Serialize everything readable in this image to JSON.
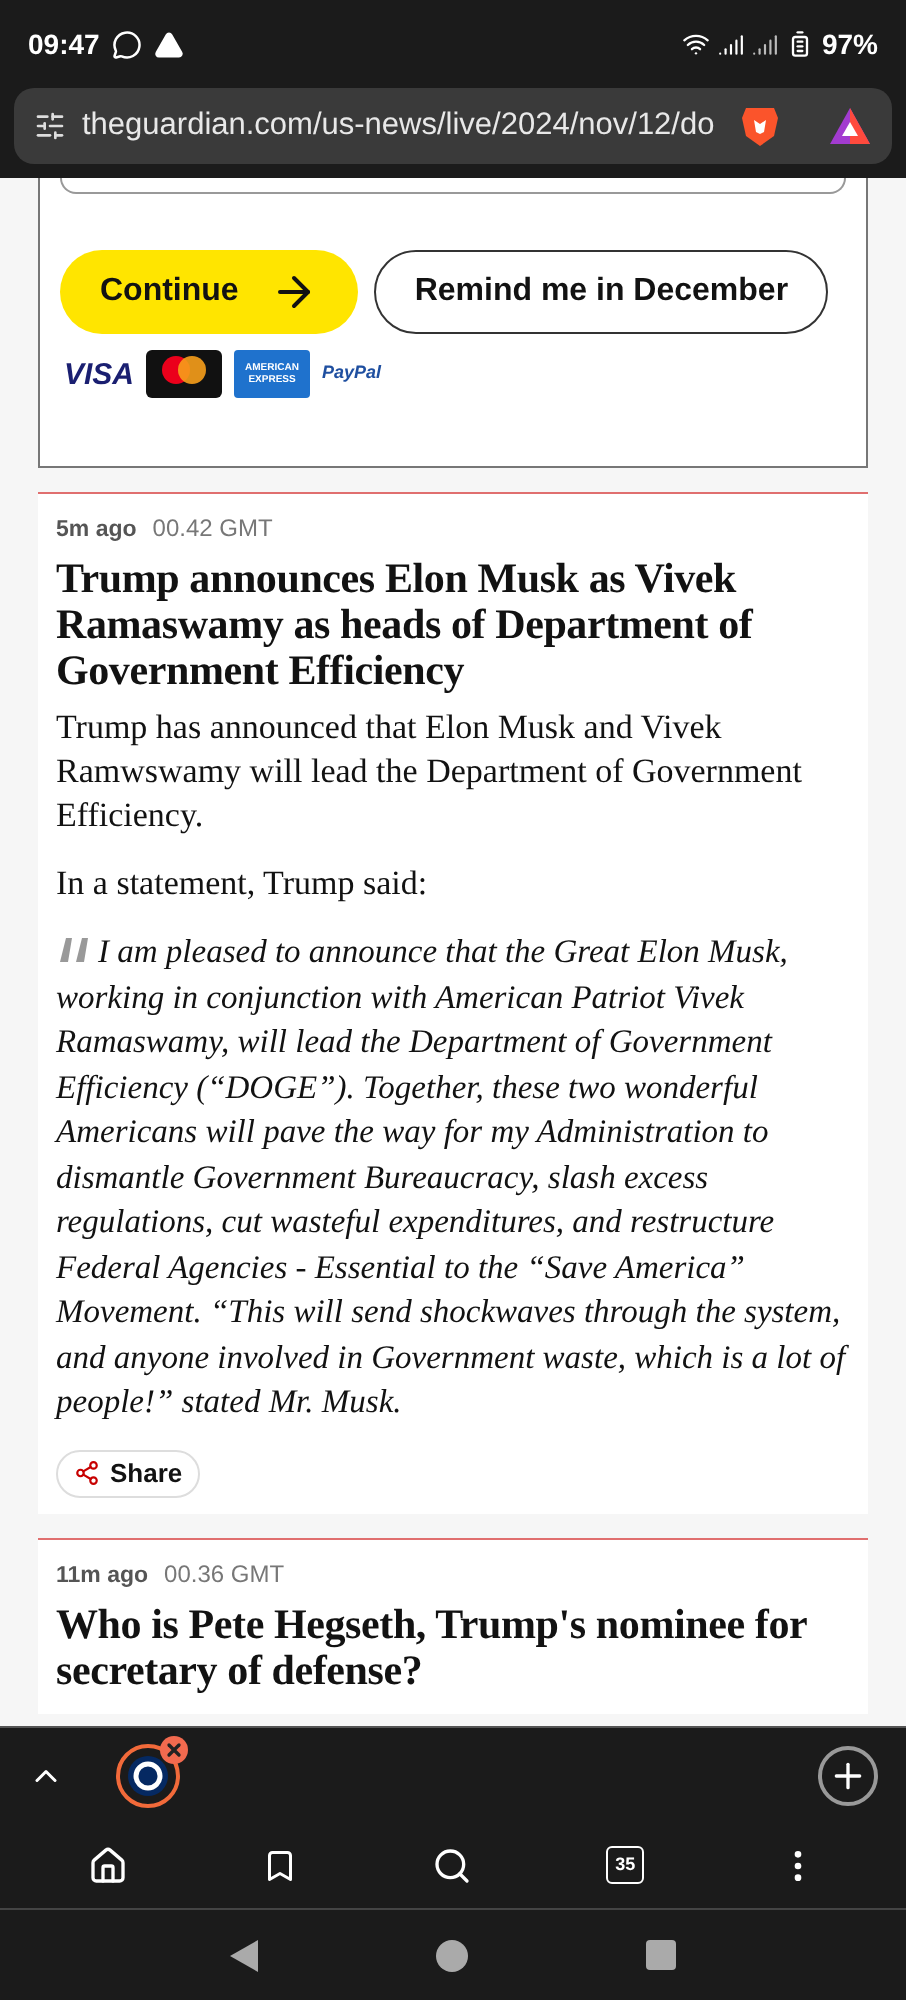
{
  "status_bar": {
    "time": "09:47",
    "battery": "97%"
  },
  "address_bar": {
    "url": "theguardian.com/us-news/live/2024/nov/12/do"
  },
  "support_box": {
    "buttons": [
      {
        "label": "Continue",
        "kind": "primary"
      },
      {
        "label": "Remind me in December",
        "kind": "secondary"
      }
    ],
    "payment_methods": [
      {
        "kind": "visa",
        "label": "VISA"
      },
      {
        "kind": "mastercard"
      },
      {
        "kind": "amex",
        "label": "AMERICAN EXPRESS"
      },
      {
        "kind": "paypal",
        "label": "PayPal"
      }
    ]
  },
  "posts": [
    {
      "ago": "5m ago",
      "time": "00.42 GMT",
      "headline": "Trump announces Elon Musk as Vivek Ramaswamy as heads of Department of Government Efficiency",
      "body": [
        {
          "kind": "paragraph",
          "text": "Trump has announced that Elon Musk and Vivek Ramwswamy will lead the Department of Government Efficiency."
        },
        {
          "kind": "paragraph",
          "text": "In a statement, Trump said:"
        },
        {
          "kind": "quote",
          "text": "I am pleased to announce that the Great Elon Musk, working in conjunction with American Patriot Vivek Ramaswamy, will lead the Department of Government Efficiency (“DOGE”). Together, these two wonderful Americans will pave the way for my Administration to dismantle Government Bureaucracy, slash excess regulations, cut wasteful expenditures, and restructure Federal Agencies - Essential to the “Save America” Movement. “This will send shockwaves through the system, and anyone involved in Government waste, which is a lot of people!” stated Mr. Musk."
        }
      ],
      "share": "Share"
    },
    {
      "ago": "11m ago",
      "time": "00.36 GMT",
      "headline": "Who is Pete Hegseth, Trump's nominee for secretary of defense?"
    }
  ],
  "tab_strip": {
    "tabs": [
      {
        "selected": true
      }
    ]
  },
  "toolbar": {
    "tab_count": "35"
  }
}
